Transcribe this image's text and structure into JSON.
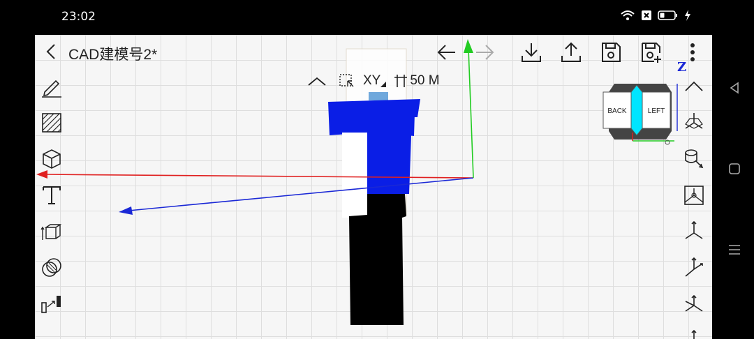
{
  "status": {
    "time": "23:02"
  },
  "app": {
    "title": "CAD建模号2*",
    "view": {
      "plane": "XY",
      "grid_size": "50 M",
      "z_label": "Z",
      "cube_faces": {
        "left": "BACK",
        "right": "LEFT"
      }
    },
    "colors": {
      "x_axis": "#e02020",
      "y_axis": "#22cc22",
      "z_axis": "#1a28d6",
      "shirt": "#0a1ee6",
      "pants": "#000000",
      "cube_highlight": "#00e5ff",
      "grid": "#dedede",
      "background": "#f6f6f6"
    },
    "icons": {
      "top_toolbar": [
        "undo-arrow-icon",
        "redo-arrow-icon",
        "import-icon",
        "export-icon",
        "save-icon",
        "save-as-icon",
        "more-icon"
      ],
      "left_tools": [
        "pencil-icon",
        "hatch-icon",
        "cube-icon",
        "text-icon",
        "extrude-icon",
        "boolean-icon",
        "measure-icon"
      ],
      "right_tools": [
        "collapse-icon",
        "view-iso-icon",
        "cylinder-view-icon",
        "image-view-icon",
        "axis-view-1-icon",
        "axis-view-2-icon",
        "axis-view-3-icon",
        "axis-view-4-icon"
      ]
    }
  }
}
